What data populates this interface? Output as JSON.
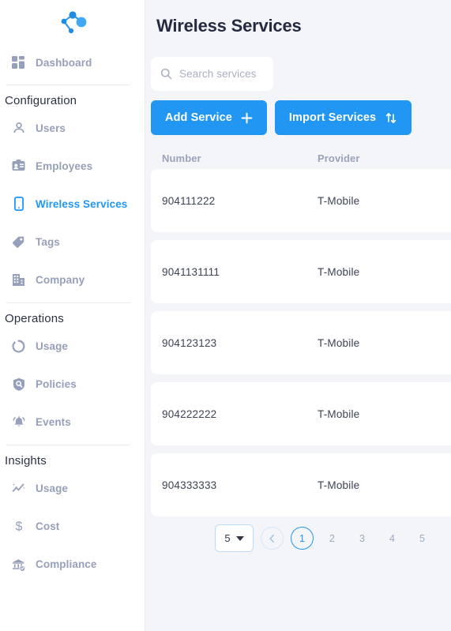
{
  "sidebar": {
    "logo": "network-graph-logo",
    "top_items": [
      {
        "label": "Dashboard",
        "icon": "dashboard-grid-icon"
      }
    ],
    "sections": [
      {
        "title": "Configuration",
        "items": [
          {
            "label": "Users",
            "icon": "user-icon",
            "active": false
          },
          {
            "label": "Employees",
            "icon": "id-badge-icon",
            "active": false
          },
          {
            "label": "Wireless Services",
            "icon": "mobile-phone-icon",
            "active": true
          },
          {
            "label": "Tags",
            "icon": "tag-icon",
            "active": false
          },
          {
            "label": "Company",
            "icon": "building-icon",
            "active": false
          }
        ]
      },
      {
        "title": "Operations",
        "items": [
          {
            "label": "Usage",
            "icon": "donut-chart-icon",
            "active": false
          },
          {
            "label": "Policies",
            "icon": "shield-search-icon",
            "active": false
          },
          {
            "label": "Events",
            "icon": "bell-icon",
            "active": false
          }
        ]
      },
      {
        "title": "Insights",
        "items": [
          {
            "label": "Usage",
            "icon": "trend-sparkle-icon",
            "active": false
          },
          {
            "label": "Cost",
            "icon": "dollar-icon",
            "active": false
          },
          {
            "label": "Compliance",
            "icon": "bank-shield-icon",
            "active": false
          }
        ]
      }
    ]
  },
  "main": {
    "title": "Wireless Services",
    "search": {
      "placeholder": "Search services",
      "value": "",
      "icon": "search-icon"
    },
    "buttons": {
      "add": {
        "label": "Add Service",
        "icon": "plus-icon"
      },
      "import": {
        "label": "Import Services",
        "icon": "up-down-arrows-icon"
      }
    },
    "table": {
      "columns": [
        "Number",
        "Provider"
      ],
      "rows": [
        {
          "number": "904111222",
          "provider": "T-Mobile"
        },
        {
          "number": "9041131111",
          "provider": "T-Mobile"
        },
        {
          "number": "904123123",
          "provider": "T-Mobile"
        },
        {
          "number": "904222222",
          "provider": "T-Mobile"
        },
        {
          "number": "904333333",
          "provider": "T-Mobile"
        }
      ]
    },
    "pagination": {
      "page_size": "5",
      "prev_icon": "chevron-left-icon",
      "pages": [
        "1",
        "2",
        "3",
        "4",
        "5"
      ],
      "active_page": "1"
    }
  },
  "colors": {
    "accent": "#2196f3",
    "title": "#242b41",
    "muted": "#97a0ba",
    "bg": "#f4f5f8"
  }
}
